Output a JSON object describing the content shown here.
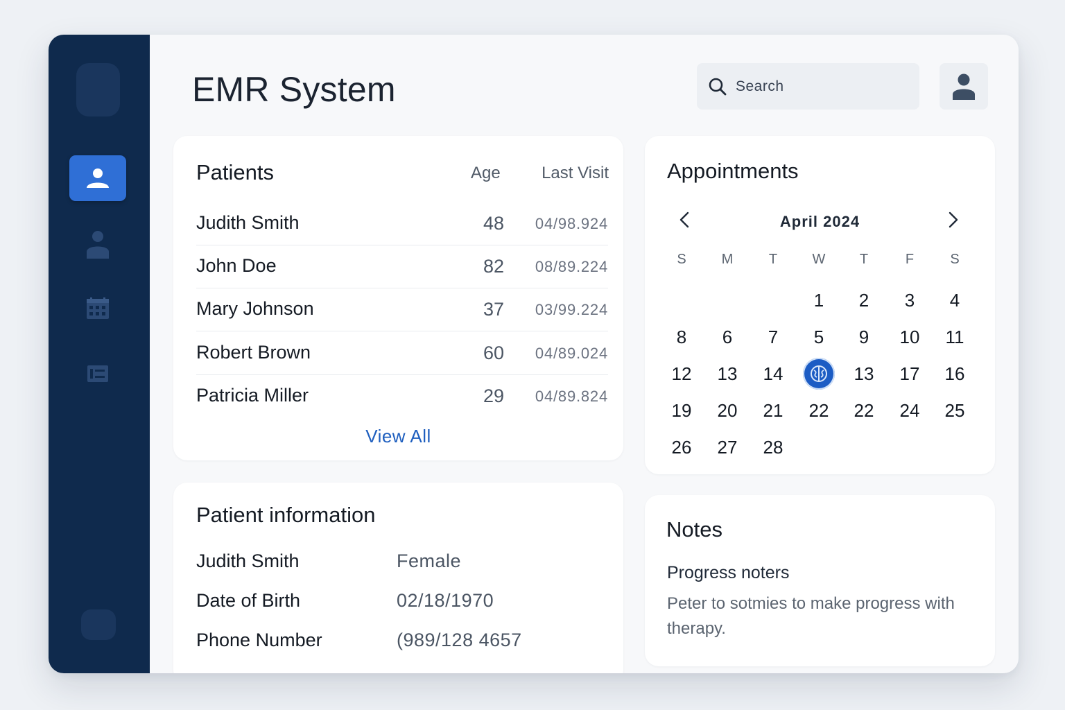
{
  "app": {
    "title": "EMR System"
  },
  "search": {
    "placeholder": "Search"
  },
  "sidebar": {
    "items": [
      {
        "name": "patients",
        "icon": "user-icon",
        "active": true
      },
      {
        "name": "profile",
        "icon": "person-icon",
        "active": false
      },
      {
        "name": "calendar",
        "icon": "calendar-icon",
        "active": false
      },
      {
        "name": "records",
        "icon": "list-icon",
        "active": false
      }
    ]
  },
  "patients": {
    "title": "Patients",
    "columns": {
      "age": "Age",
      "last_visit": "Last Visit"
    },
    "rows": [
      {
        "name": "Judith Smith",
        "age": "48",
        "last_visit": "04/98.924"
      },
      {
        "name": "John Doe",
        "age": "82",
        "last_visit": "08/89.224"
      },
      {
        "name": "Mary Johnson",
        "age": "37",
        "last_visit": "03/99.224"
      },
      {
        "name": "Robert Brown",
        "age": "60",
        "last_visit": "04/89.024"
      },
      {
        "name": "Patricia Miller",
        "age": "29",
        "last_visit": "04/89.824"
      }
    ],
    "view_all": "View All"
  },
  "patient_info": {
    "title": "Patient information",
    "fields": [
      {
        "label": "Judith Smith",
        "value": "Female"
      },
      {
        "label": "Date of Birth",
        "value": "02/18/1970"
      },
      {
        "label": "Phone Number",
        "value": "(989/128 4657"
      }
    ]
  },
  "appointments": {
    "title": "Appointments",
    "month": "April 2024",
    "weekdays": [
      "S",
      "M",
      "T",
      "W",
      "T",
      "F",
      "S"
    ],
    "weeks": [
      [
        "",
        "",
        "",
        "1",
        "2",
        "3",
        "4"
      ],
      [
        "8",
        "6",
        "7",
        "5",
        "9",
        "10",
        "11"
      ],
      [
        "12",
        "13",
        "14",
        "",
        "13",
        "17",
        "16"
      ],
      [
        "19",
        "20",
        "21",
        "22",
        "22",
        "24",
        "25"
      ],
      [
        "26",
        "27",
        "28",
        "",
        "",
        "",
        ""
      ]
    ],
    "selected": {
      "week": 2,
      "day": 3
    }
  },
  "notes": {
    "title": "Notes",
    "subtitle": "Progress noters",
    "body": "Peter to sotmies to make progress with therapy."
  },
  "colors": {
    "sidebar": "#0f2a4d",
    "accent": "#2f6fd6",
    "link": "#1f5fbf",
    "selected_day": "#1c5cc4"
  }
}
